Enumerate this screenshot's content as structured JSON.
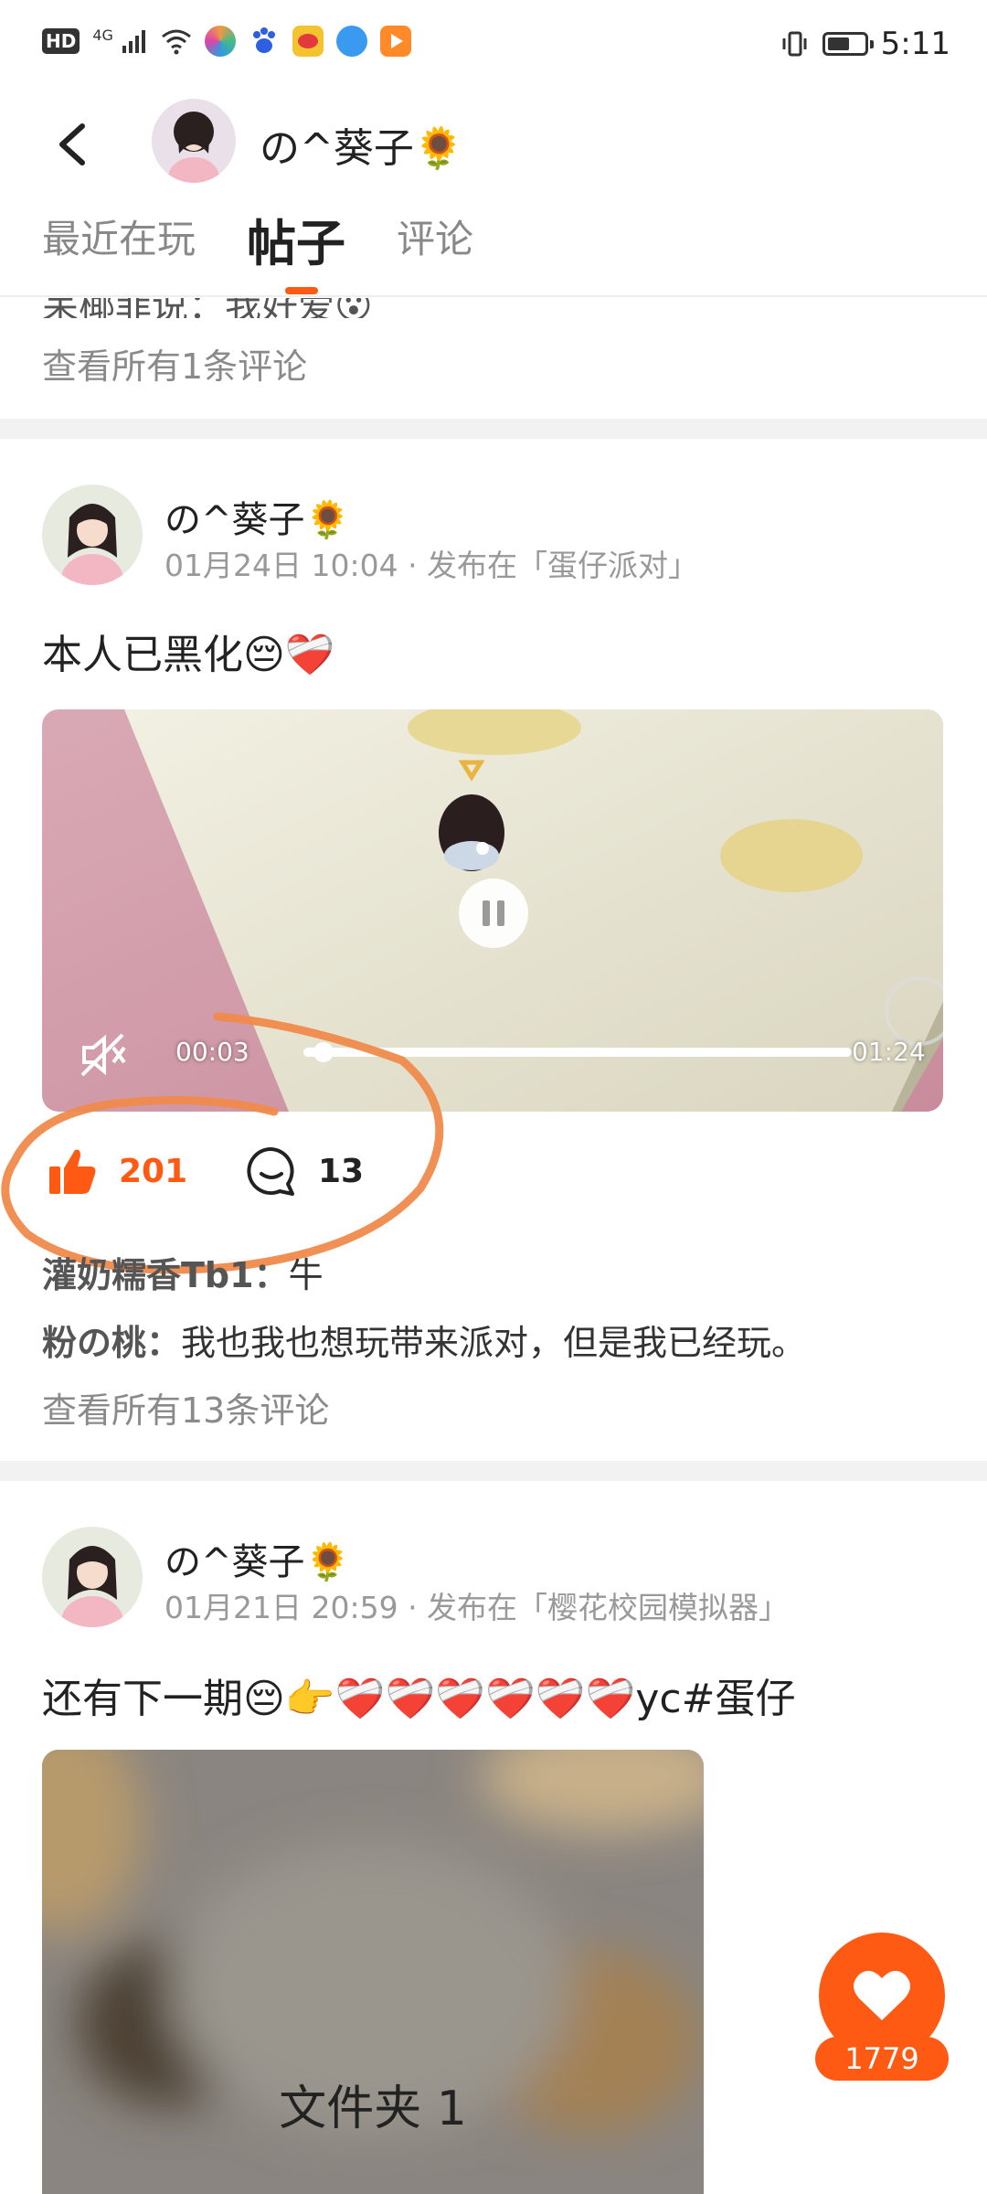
{
  "status_bar": {
    "network_badge": "HD",
    "network_type": "4G",
    "time": "5:11",
    "battery_level": 0.6
  },
  "header": {
    "username": "の^葵子🌻"
  },
  "tabs": [
    {
      "label": "最近在玩"
    },
    {
      "label": "帖子",
      "active": true
    },
    {
      "label": "评论"
    }
  ],
  "prev_post": {
    "partial_comment": "呆椰菲说：我好爱😮",
    "view_all": "查看所有1条评论"
  },
  "post1": {
    "user": "の^葵子🌻",
    "meta": "01月24日 10:04 · 发布在「蛋仔派对」",
    "text": "本人已黑化😔❤️‍🩹",
    "video": {
      "current_time": "00:03",
      "duration": "01:24",
      "progress": 0.036
    },
    "likes": "201",
    "comments_count": "13",
    "comments": [
      {
        "user": "灌奶糯香Tb1：",
        "text": "牛"
      },
      {
        "user": "粉の桃：",
        "text": "我也我也想玩带来派对，但是我已经玩。"
      }
    ],
    "view_all": "查看所有13条评论"
  },
  "post2": {
    "user": "の^葵子🌻",
    "meta": "01月21日 20:59 · 发布在「樱花校园模拟器」",
    "text": "还有下一期😔👉❤️‍🩹❤️‍🩹❤️‍🩹❤️‍🩹❤️‍🩹❤️‍🩹yc#蛋仔",
    "image_label": "文件夹 1"
  },
  "fab": {
    "count": "1779"
  },
  "colors": {
    "accent": "#ff5a14",
    "separator": "#f2f2f2"
  }
}
